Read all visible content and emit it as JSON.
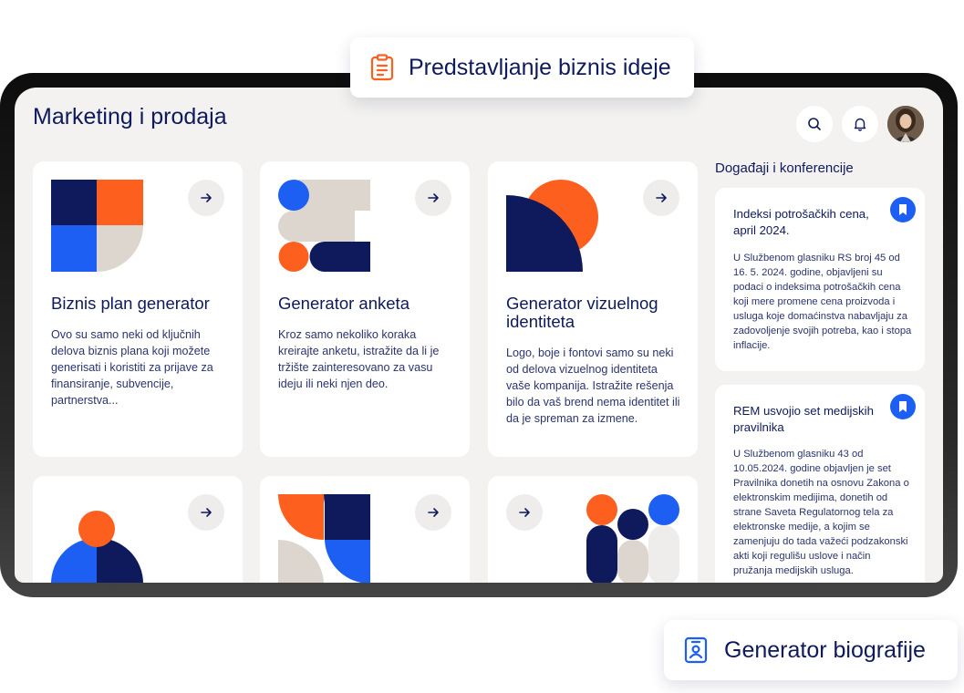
{
  "header": {
    "title": "Marketing i prodaja"
  },
  "floating": {
    "top_label": "Predstavljanje biznis ideje",
    "bottom_label": "Generator biografije",
    "top_icon": "clipboard-icon",
    "bottom_icon": "id-badge-icon"
  },
  "cards": [
    {
      "title": "Biznis plan generator",
      "description": "Ovo su samo neki od ključnih delova biznis plana koji možete generisati i koristiti za prijave za finansiranje, subvencije, partnerstva..."
    },
    {
      "title": "Generator anketa",
      "description": "Kroz samo nekoliko koraka kreirajte anketu, istražite da li je tržište zainteresovano za vasu ideju ili neki njen deo."
    },
    {
      "title": "Generator vizuelnog identiteta",
      "description": "Logo, boje i fontovi samo su neki od delova vizuelnog identiteta vaše kompanija. Istražite rešenja bilo da vaš brend nema identitet ili da je spreman za izmene."
    }
  ],
  "events": {
    "heading": "Događaji i konferencije",
    "items": [
      {
        "title": "Indeksi potrošačkih cena, april 2024.",
        "text": "U Službenom glasniku RS broj 45 od 16. 5. 2024. godine, objavljeni su podaci o indeksima potrošačkih cena koji mere promene cena proizvoda i usluga koje domaćinstva nabavljaju za zadovoljenje svojih potreba, kao i stopa inflacije."
      },
      {
        "title": "REM usvojio set medijskih pravilnika",
        "text": "U Službenom glasniku 43 od 10.05.2024. godine objavljen je set Pravilnika donetih na osnovu Zakona o elektronskim medijima, donetih od strane Saveta Regulatornog tela za elektronske medije, a kojim se zamenjuju do tada važeći podzakonski akti koji regulišu uslove i način pružanja medijskih usluga."
      }
    ]
  },
  "colors": {
    "navy": "#0e1a5c",
    "orange": "#fd5f1e",
    "blue": "#1c5ff2",
    "beige": "#ddd6cf",
    "background": "#f3f2f0"
  }
}
